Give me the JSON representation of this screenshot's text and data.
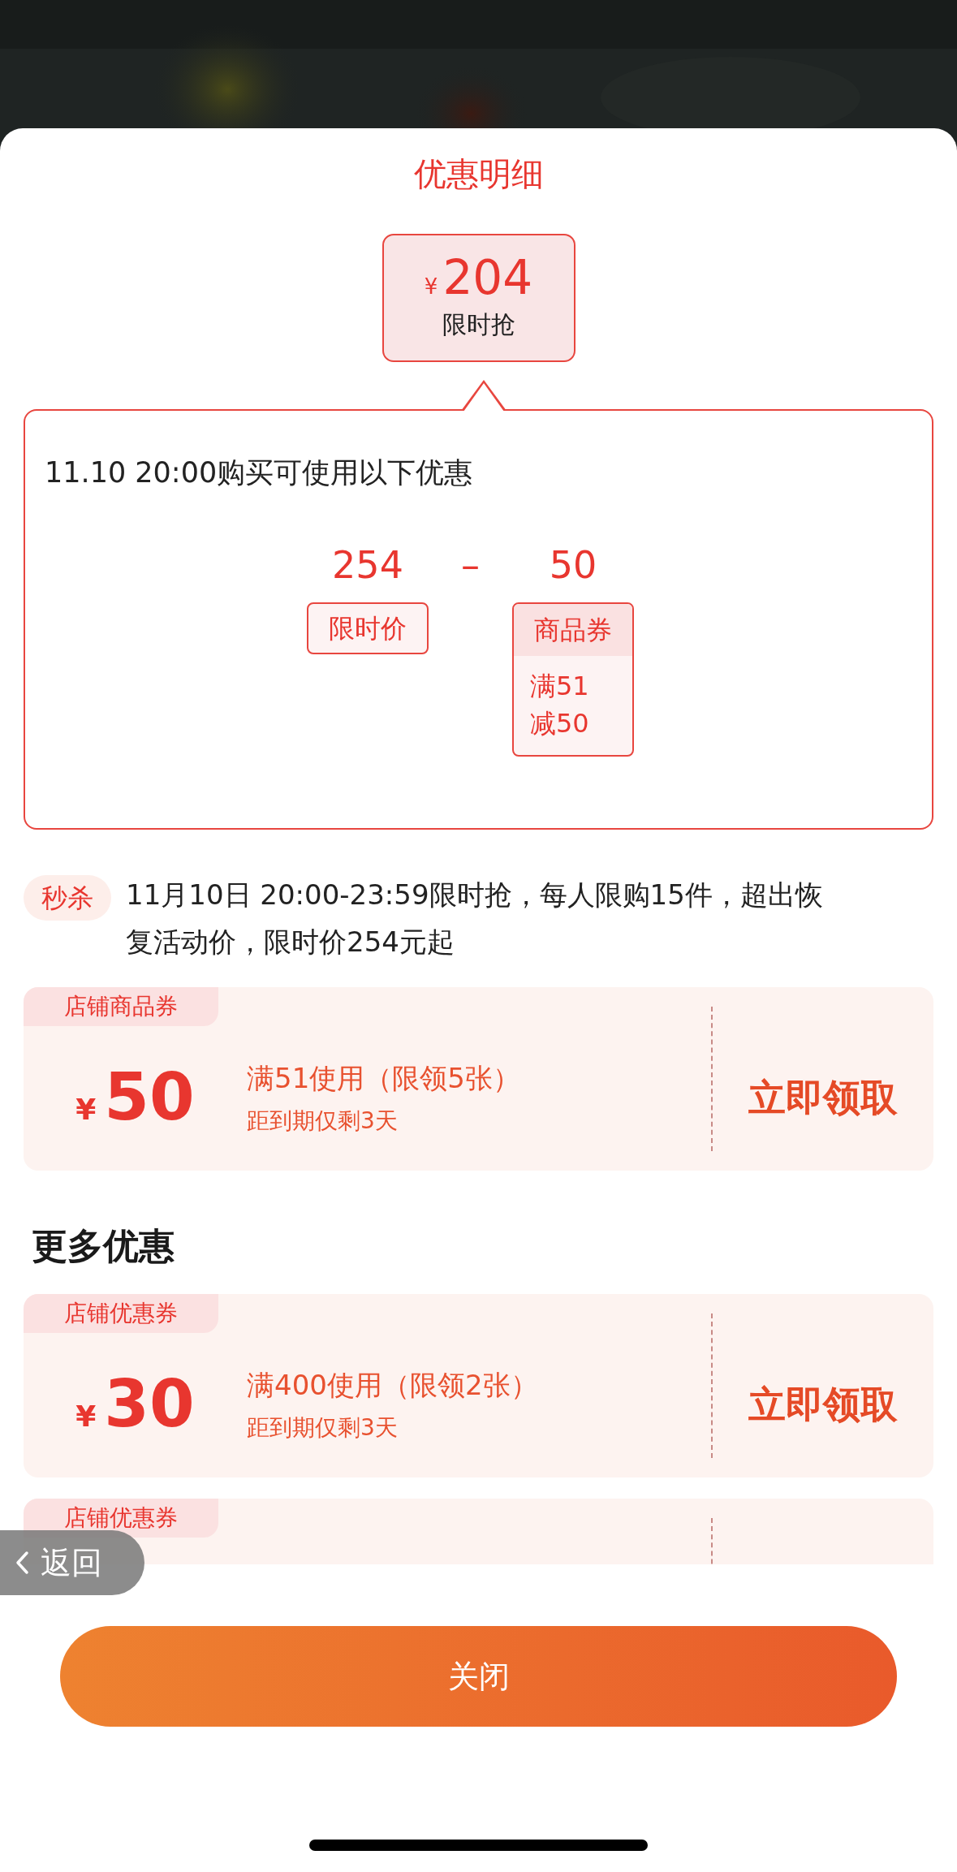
{
  "sheet": {
    "title": "优惠明细"
  },
  "price_tag": {
    "currency": "¥",
    "amount": "204",
    "label": "限时抢"
  },
  "breakdown": {
    "heading": "11.10 20:00购买可使用以下优惠",
    "operator": "–",
    "terms": [
      {
        "value": "254",
        "tag": "限时价"
      },
      {
        "value": "50",
        "tag": "商品券",
        "details": [
          "满51",
          "减50"
        ]
      }
    ]
  },
  "promotion": {
    "badge": "秒杀",
    "text": "11月10日 20:00-23:59限时抢，每人限购15件，超出恢复活动价，限时价254元起"
  },
  "coupons": [
    {
      "tag": "店铺商品券",
      "currency": "¥",
      "amount": "50",
      "condition": "满51使用（限领5张）",
      "expiry": "距到期仅剩3天",
      "action": "立即领取"
    }
  ],
  "more_heading": "更多优惠",
  "more_coupons": [
    {
      "tag": "店铺优惠券",
      "currency": "¥",
      "amount": "30",
      "condition": "满400使用（限领2张）",
      "expiry": "距到期仅剩3天",
      "action": "立即领取"
    },
    {
      "tag": "店铺优惠券"
    }
  ],
  "back_button": {
    "label": "返回"
  },
  "close_button": {
    "label": "关闭"
  }
}
